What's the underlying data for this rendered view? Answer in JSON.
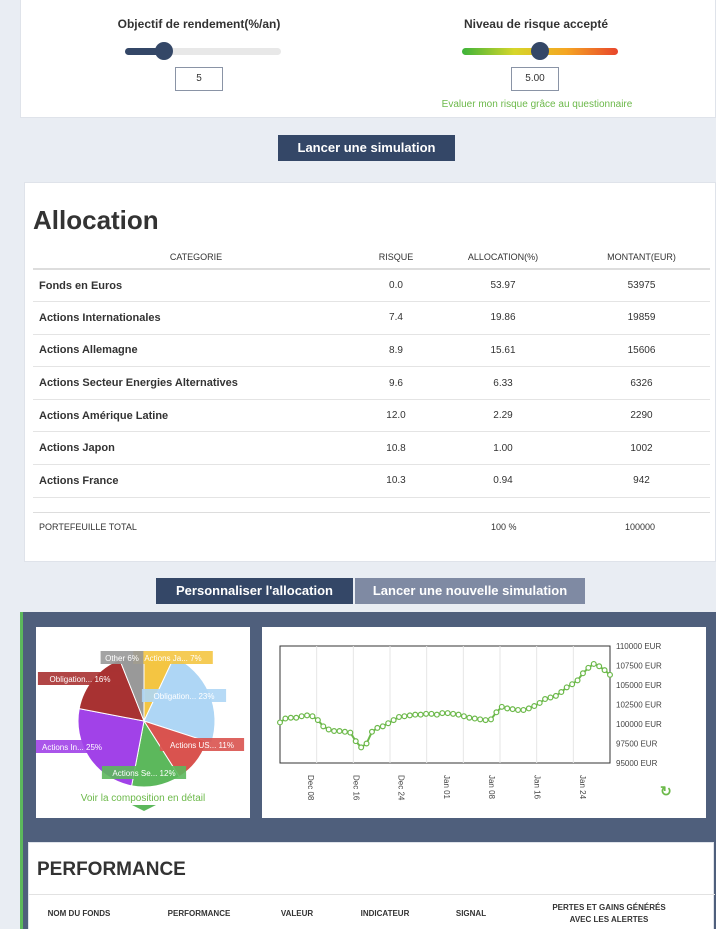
{
  "sliders": {
    "return": {
      "label": "Objectif de rendement(%/an)",
      "value": "5",
      "level": 0.25
    },
    "risk": {
      "label": "Niveau de risque accepté",
      "value": "5.00",
      "level": 0.5,
      "link": "Evaluer mon risque grâce au questionnaire"
    }
  },
  "buttons": {
    "simulate": "Lancer une simulation",
    "customize": "Personnaliser l'allocation",
    "new_simulation": "Lancer une nouvelle simulation"
  },
  "allocation": {
    "title": "Allocation",
    "headers": [
      "CATEGORIE",
      "RISQUE",
      "ALLOCATION(%)",
      "MONTANT(EUR)"
    ],
    "rows": [
      [
        "Fonds en Euros",
        "0.0",
        "53.97",
        "53975"
      ],
      [
        "Actions Internationales",
        "7.4",
        "19.86",
        "19859"
      ],
      [
        "Actions Allemagne",
        "8.9",
        "15.61",
        "15606"
      ],
      [
        "Actions Secteur Energies Alternatives",
        "9.6",
        "6.33",
        "6326"
      ],
      [
        "Actions Amérique Latine",
        "12.0",
        "2.29",
        "2290"
      ],
      [
        "Actions Japon",
        "10.8",
        "1.00",
        "1002"
      ],
      [
        "Actions France",
        "10.3",
        "0.94",
        "942"
      ]
    ],
    "total": {
      "label": "PORTEFEUILLE TOTAL",
      "allocation": "100 %",
      "amount": "100000"
    }
  },
  "pie": {
    "link": "Voir la composition en détail",
    "slices": [
      {
        "label": "Actions Ja... 7%",
        "value": 7,
        "color": "#f4c542"
      },
      {
        "label": "Obligation... 23%",
        "value": 23,
        "color": "#aed6f5"
      },
      {
        "label": "Actions US... 11%",
        "value": 11,
        "color": "#d9534f"
      },
      {
        "label": "Actions Se... 12%",
        "value": 12,
        "color": "#5cb85c"
      },
      {
        "label": "Actions In... 25%",
        "value": 25,
        "color": "#a142e8"
      },
      {
        "label": "Obligation... 16%",
        "value": 16,
        "color": "#a83232"
      },
      {
        "label": "Other 6%",
        "value": 6,
        "color": "#999999"
      }
    ]
  },
  "line_chart": {
    "y_ticks": [
      "110000 EUR",
      "107500 EUR",
      "105000 EUR",
      "102500 EUR",
      "100000 EUR",
      "97500 EUR",
      "95000 EUR"
    ],
    "x_ticks": [
      "Dec 08",
      "Dec 16",
      "Dec 24",
      "Jan 01",
      "Jan 08",
      "Jan 16",
      "Jan 24"
    ],
    "color": "#6cb94a",
    "values": [
      100200,
      100700,
      100800,
      100800,
      101000,
      101100,
      101000,
      100500,
      99700,
      99300,
      99100,
      99100,
      99000,
      98900,
      97800,
      97000,
      97500,
      99000,
      99500,
      99700,
      100100,
      100500,
      100900,
      101000,
      101100,
      101200,
      101200,
      101300,
      101300,
      101200,
      101400,
      101400,
      101300,
      101200,
      101000,
      100800,
      100700,
      100600,
      100500,
      100600,
      101500,
      102200,
      102000,
      101900,
      101800,
      101800,
      102000,
      102300,
      102700,
      103200,
      103400,
      103600,
      104100,
      104700,
      105100,
      105600,
      106500,
      107200,
      107700,
      107400,
      106900,
      106300
    ]
  },
  "performance": {
    "title": "PERFORMANCE",
    "headers": [
      "NOM DU FONDS",
      "PERFORMANCE",
      "VALEUR",
      "INDICATEUR",
      "SIGNAL",
      "PERTES ET GAINS GÉNÉRÉS AVEC LES ALERTES"
    ]
  }
}
